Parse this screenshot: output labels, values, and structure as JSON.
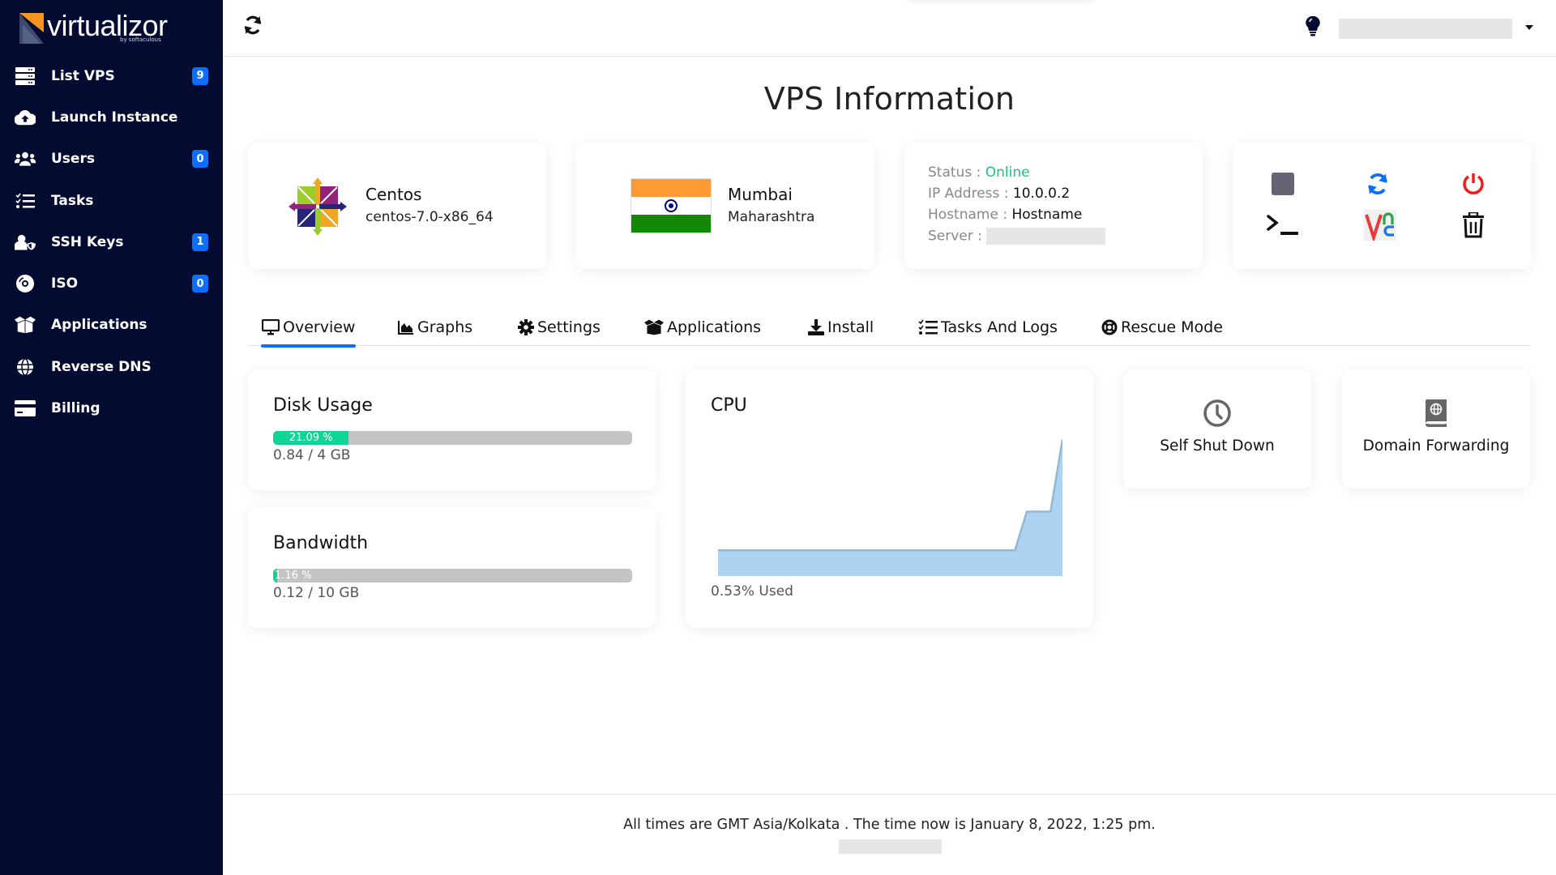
{
  "brand": {
    "name": "virtualizor",
    "sub": "by softaculous"
  },
  "sidebar": {
    "items": [
      {
        "label": "List VPS",
        "icon": "server-icon",
        "badge": "9"
      },
      {
        "label": "Launch Instance",
        "icon": "cloud-upload-icon",
        "badge": null
      },
      {
        "label": "Users",
        "icon": "users-icon",
        "badge": "0"
      },
      {
        "label": "Tasks",
        "icon": "tasks-icon",
        "badge": null
      },
      {
        "label": "SSH Keys",
        "icon": "user-shield-icon",
        "badge": "1"
      },
      {
        "label": "ISO",
        "icon": "disc-icon",
        "badge": "0"
      },
      {
        "label": "Applications",
        "icon": "box-open-icon",
        "badge": null
      },
      {
        "label": "Reverse DNS",
        "icon": "globe-icon",
        "badge": null
      },
      {
        "label": "Billing",
        "icon": "credit-card-icon",
        "badge": null
      }
    ]
  },
  "page": {
    "title": "VPS Information"
  },
  "os": {
    "name": "Centos",
    "template": "centos-7.0-x86_64"
  },
  "location": {
    "city": "Mumbai",
    "state": "Maharashtra"
  },
  "info": {
    "status_label": "Status : ",
    "status_value": "Online",
    "ip_label": "IP Address : ",
    "ip_value": "10.0.0.2",
    "hostname_label": "Hostname : ",
    "hostname_value": "Hostname",
    "server_label": "Server : "
  },
  "actions": [
    "stop",
    "restart",
    "power-off",
    "console",
    "vnc",
    "delete"
  ],
  "tabs": [
    {
      "label": "Overview",
      "active": true
    },
    {
      "label": "Graphs"
    },
    {
      "label": "Settings"
    },
    {
      "label": "Applications"
    },
    {
      "label": "Install"
    },
    {
      "label": "Tasks And Logs"
    },
    {
      "label": "Rescue Mode"
    }
  ],
  "disk": {
    "title": "Disk Usage",
    "percent": 21.09,
    "percent_label": "21.09 %",
    "usage": "0.84 / 4 GB"
  },
  "bandwidth": {
    "title": "Bandwidth",
    "percent": 1.16,
    "percent_label": "1.16 %",
    "usage": "0.12 / 10 GB"
  },
  "cpu": {
    "title": "CPU",
    "used_label": "0.53% Used"
  },
  "chart_data": {
    "type": "area",
    "title": "CPU",
    "xlabel": "",
    "ylabel": "",
    "x": [
      0,
      1,
      2,
      3,
      4,
      5,
      6,
      7,
      8,
      9,
      10,
      11,
      12,
      13,
      14,
      15,
      16,
      17,
      18,
      19,
      20,
      21,
      22,
      23,
      24,
      25,
      26,
      27,
      28,
      29
    ],
    "values": [
      0.1,
      0.1,
      0.1,
      0.1,
      0.1,
      0.1,
      0.1,
      0.1,
      0.1,
      0.1,
      0.1,
      0.1,
      0.1,
      0.1,
      0.1,
      0.1,
      0.1,
      0.1,
      0.1,
      0.1,
      0.1,
      0.1,
      0.1,
      0.1,
      0.1,
      0.1,
      0.25,
      0.25,
      0.25,
      0.53
    ],
    "ylim": [
      0,
      0.55
    ],
    "grid": false,
    "color": "#aed3f1"
  },
  "tiles": [
    {
      "label": "Self Shut Down",
      "icon": "clock-icon"
    },
    {
      "label": "Domain Forwarding",
      "icon": "globe-book-icon"
    }
  ],
  "footer": {
    "text": "All times are GMT Asia/Kolkata . The time now is January 8, 2022, 1:25 pm."
  }
}
